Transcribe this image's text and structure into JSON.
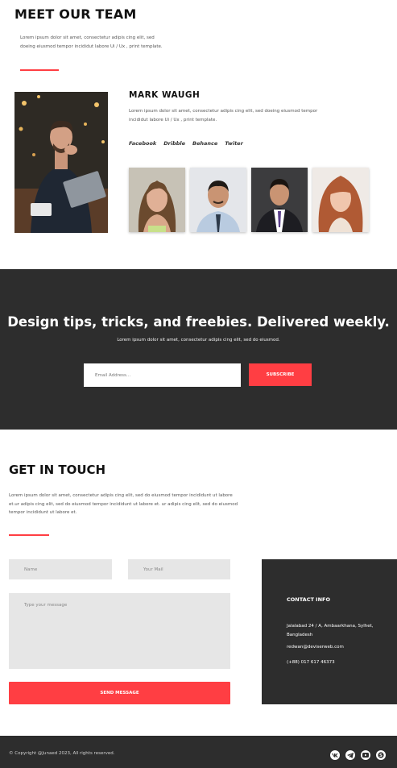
{
  "team": {
    "title": "MEET OUR TEAM",
    "intro": "Lorem ipsum dolor sit amet, consectetur adipis cing elit, sed doeing eiusmod tempor incididut labore Ui / Ux , print template.",
    "member": {
      "name": "MARK WAUGH",
      "bio": "Lorem ipsum dolor sit amet, consectetur adipis cing elit, sed doeing eiusmod tempor incididut labore Ui / Ux , print template.",
      "social": [
        "Facebook",
        "Dribble",
        "Behance",
        "Twiter"
      ]
    }
  },
  "newsletter": {
    "title": "Design tips, tricks, and freebies. Delivered weekly.",
    "subtitle": "Lorem ipsum dolor sit amet, consectetur adipis cing elit, sed do eiusmod.",
    "email_placeholder": "Email Address...",
    "button_label": "SUBSCRIBE"
  },
  "contact": {
    "title": "GET IN TOUCH",
    "intro": "Lorem ipsum dolor sit amet, consectetur adipis cing elit, sed do eiusmod tempor incididunt ut labore et.ur adipis cing elit, sed do eiusmod tempor incididunt ut labore et. ur adipis cing elit, sed do eiusmod tempor incididunt ut labore et.",
    "name_placeholder": "Name",
    "mail_placeholder": "Your Mail",
    "message_placeholder": "Type your message",
    "send_label": "SEND MESSAGE",
    "info": {
      "title": "CONTACT INFO",
      "address": "Jalalabad 24 / A, Ambaarkhana, Sylhet, Bangladesh",
      "email": "redwan@deviserweb.com",
      "phone": "(+88) 017 617 46373"
    }
  },
  "footer": {
    "copyright": "© Copyright @Junaed 2023, All rights reserved.",
    "icons": [
      "vk-icon",
      "telegram-icon",
      "youtube-icon",
      "skype-icon"
    ]
  },
  "colors": {
    "accent": "#ff3e43",
    "dark": "#2d2d2d"
  }
}
